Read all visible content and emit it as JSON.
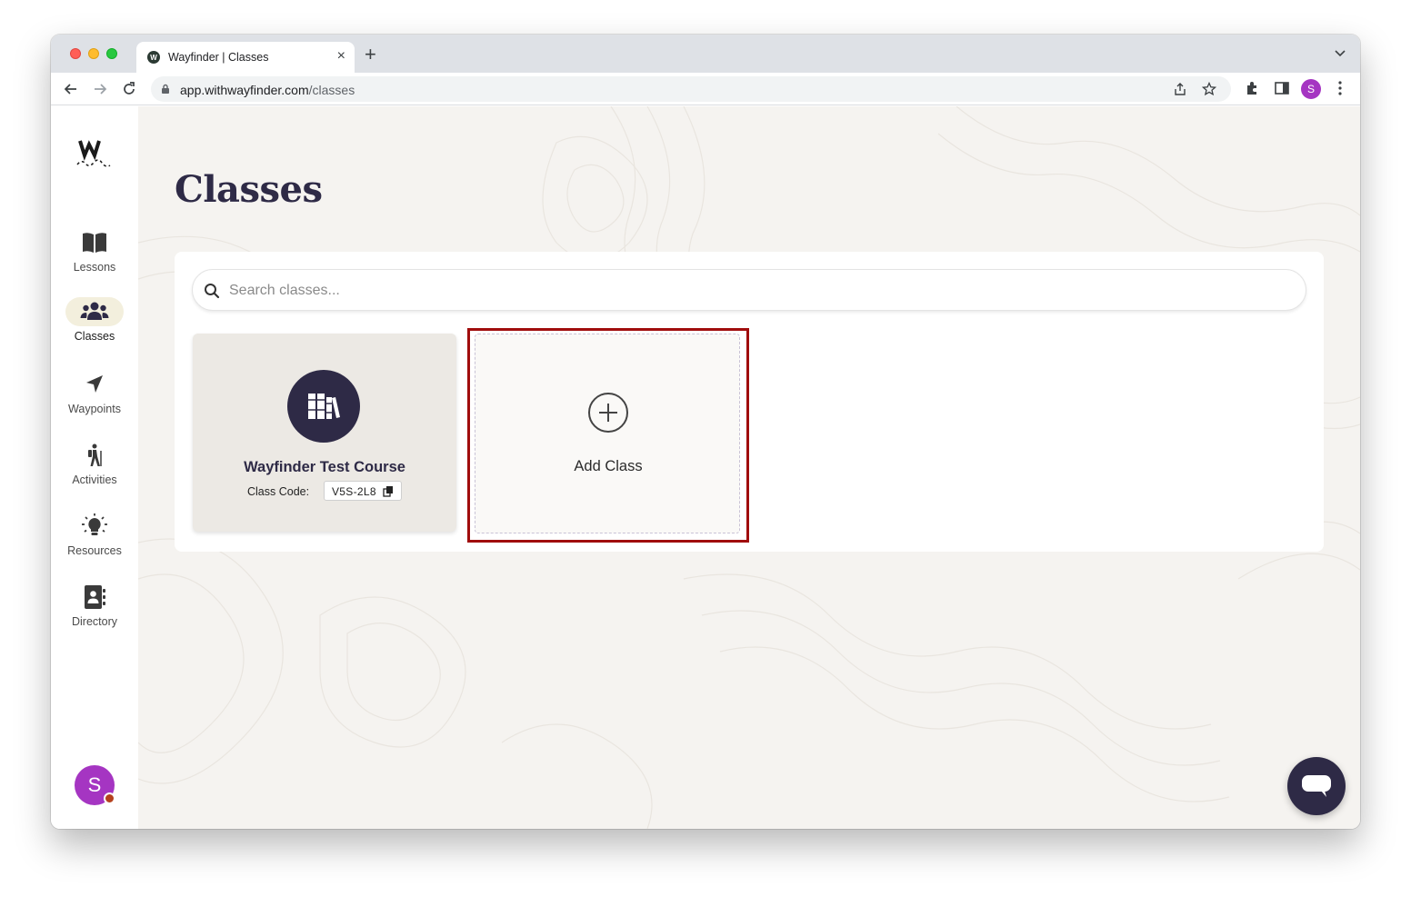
{
  "browser": {
    "tab_title": "Wayfinder | Classes",
    "tab_favicon_letter": "W",
    "url_host": "app.withwayfinder.com",
    "url_path": "/classes",
    "profile_letter": "S"
  },
  "sidebar": {
    "logo_letter": "W",
    "items": [
      {
        "label": "Lessons",
        "icon": "book-icon"
      },
      {
        "label": "Classes",
        "icon": "users-icon",
        "active": true
      },
      {
        "label": "Waypoints",
        "icon": "location-arrow-icon"
      },
      {
        "label": "Activities",
        "icon": "hiker-icon"
      },
      {
        "label": "Resources",
        "icon": "lightbulb-icon"
      },
      {
        "label": "Directory",
        "icon": "address-book-icon"
      }
    ],
    "user_avatar_letter": "S"
  },
  "main": {
    "title": "Classes",
    "search": {
      "placeholder": "Search classes..."
    },
    "classes": [
      {
        "name": "Wayfinder Test Course",
        "code_label": "Class Code:",
        "code": "V5S-2L8"
      }
    ],
    "add_class_label": "Add Class"
  },
  "colors": {
    "brand_dark": "#2e2a46",
    "highlight": "#a00d0d",
    "avatar": "#a535c2",
    "active_nav_bg": "#f3efdd"
  }
}
